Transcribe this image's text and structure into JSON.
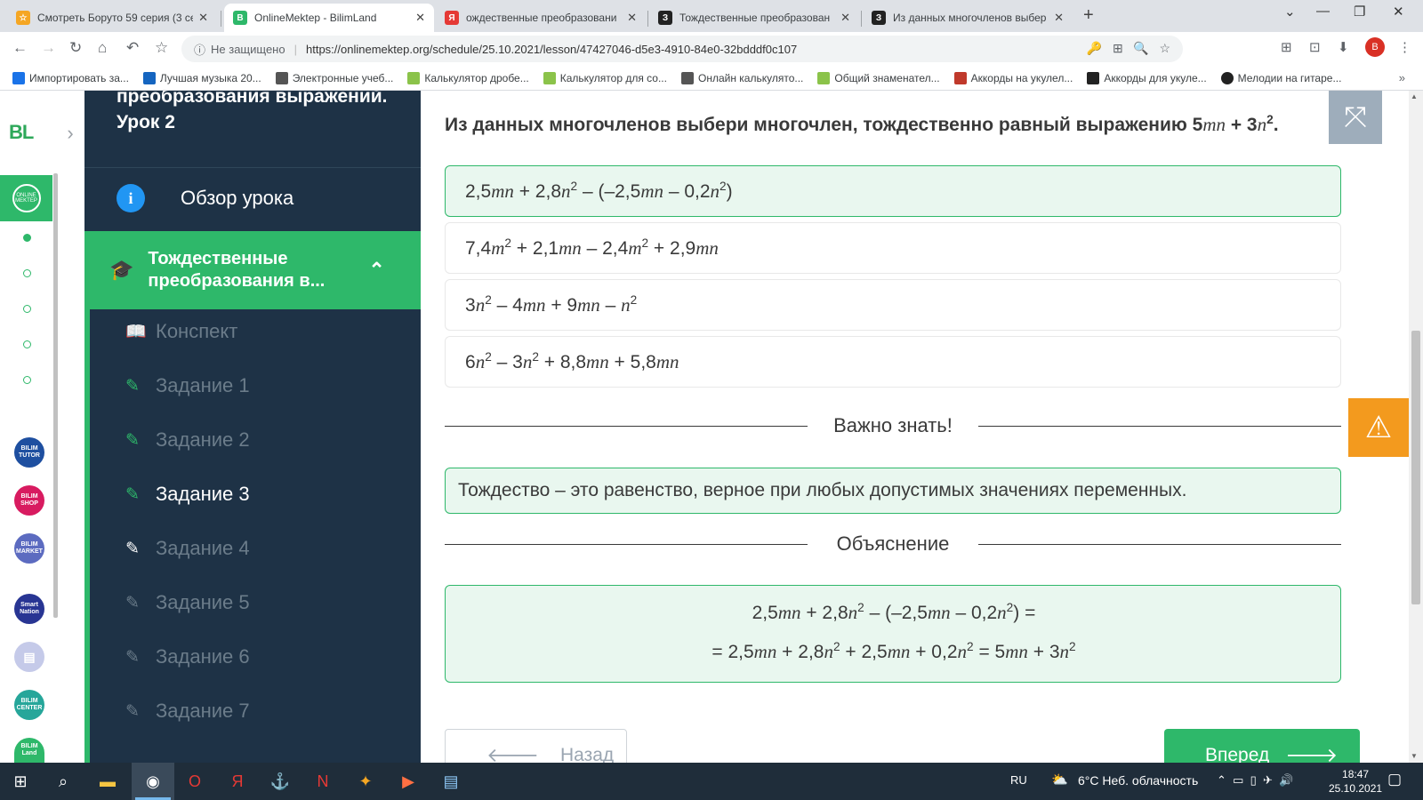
{
  "browser": {
    "tabs": [
      {
        "title": "Смотреть Боруто 59 серия (3 се",
        "color": "#f5a623",
        "glyph": "☆"
      },
      {
        "title": "OnlineMektep - BilimLand",
        "color": "#2eb86a",
        "glyph": "B"
      },
      {
        "title": "ождественные преобразовани",
        "color": "#e53935",
        "glyph": "Я"
      },
      {
        "title": "Тождественные преобразован",
        "color": "#222222",
        "glyph": "З"
      },
      {
        "title": "Из данных многочленов выбер",
        "color": "#222222",
        "glyph": "З"
      }
    ],
    "close_glyph": "✕",
    "new_tab_glyph": "+",
    "security_label": "Не защищено",
    "url": "https://onlinemektep.org/schedule/25.10.2021/lesson/47427046-d5e3-4910-84e0-32bdddf0c107",
    "profile_letter": "B",
    "bookmarks": [
      {
        "label": "Импортировать за...",
        "color": "#1a73e8"
      },
      {
        "label": "Лучшая музыка 20...",
        "color": "#1565c0"
      },
      {
        "label": "Электронные учеб...",
        "color": "#555555"
      },
      {
        "label": "Калькулятор дробе...",
        "color": "#8bc34a"
      },
      {
        "label": "Калькулятор для со...",
        "color": "#8bc34a"
      },
      {
        "label": "Онлайн калькулято...",
        "color": "#555555"
      },
      {
        "label": "Общий знаменател...",
        "color": "#8bc34a"
      },
      {
        "label": "Аккорды на укулел...",
        "color": "#c0392b"
      },
      {
        "label": "Аккорды для укуле...",
        "color": "#222222"
      },
      {
        "label": "Мелодии на гитаре...",
        "color": "#222222"
      }
    ],
    "bookmarks_more": "»"
  },
  "rail": {
    "logo": "BL",
    "online_badge": "ONLINE MEKTEP",
    "services": [
      {
        "label": "BILIM TUTOR",
        "color": "#1e4fa0"
      },
      {
        "label": "BILIM SHOP",
        "color": "#d81b60"
      },
      {
        "label": "BILIM MARKET",
        "color": "#5c6bc0"
      },
      {
        "label": "Smart Nation",
        "color": "#283593"
      },
      {
        "label": "▤",
        "color": "#c5cae9"
      },
      {
        "label": "BILIM CENTER",
        "color": "#26a69a"
      },
      {
        "label": "BILIM Land",
        "color": "#2eb86a"
      }
    ]
  },
  "sidebar": {
    "lesson_title": "преобразования выражений. Урок 2",
    "overview_label": "Обзор урока",
    "section_label": "Тождественные преобразования в...",
    "items": [
      {
        "label": "Конспект"
      },
      {
        "label": "Задание 1"
      },
      {
        "label": "Задание 2"
      },
      {
        "label": "Задание 3"
      },
      {
        "label": "Задание 4"
      },
      {
        "label": "Задание 5"
      },
      {
        "label": "Задание 6"
      },
      {
        "label": "Задание 7"
      }
    ]
  },
  "question": {
    "text": "Из данных многочленов выбери многочлен, тождественно равный выражению 5",
    "var1": "mn",
    "plus": " + 3",
    "var2": "n",
    "exp": "2",
    "end": "."
  },
  "options": [
    {
      "id": "opt1",
      "selected": true
    },
    {
      "id": "opt2",
      "selected": false
    },
    {
      "id": "opt3",
      "selected": false
    },
    {
      "id": "opt4",
      "selected": false
    }
  ],
  "important": {
    "heading": "Важно знать!",
    "text": "Тождество – это равенство, верное при любых допустимых значениях переменных."
  },
  "explanation": {
    "heading": "Объяснение"
  },
  "nav": {
    "back_label": "Назад",
    "next_label": "Вперед"
  },
  "taskbar": {
    "lang": "RU",
    "weather": "6°C  Неб. облачность",
    "time": "18:47",
    "date": "25.10.2021"
  }
}
